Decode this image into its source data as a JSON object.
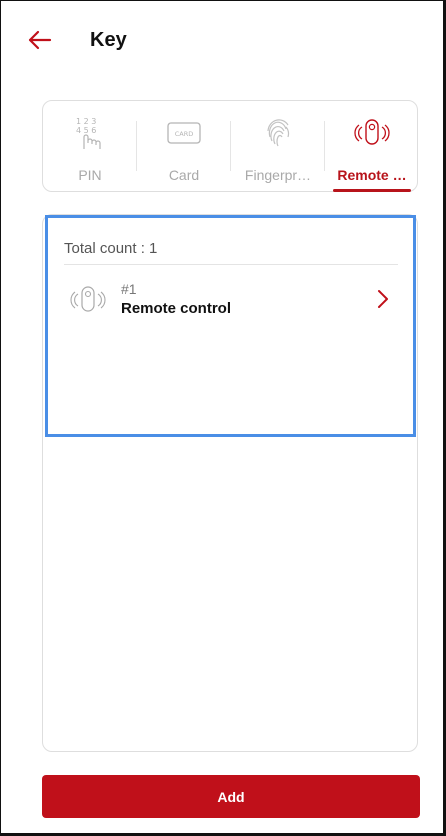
{
  "header": {
    "title": "Key",
    "back_icon": "arrow-left-icon"
  },
  "tabs": [
    {
      "label": "PIN",
      "icon": "pin-keypad-icon",
      "active": false
    },
    {
      "label": "Card",
      "icon": "card-icon",
      "card_text": "CARD",
      "active": false
    },
    {
      "label": "Fingerpr…",
      "icon": "fingerprint-icon",
      "active": false
    },
    {
      "label": "Remote …",
      "icon": "remote-control-icon",
      "active": true
    }
  ],
  "list": {
    "total_count_label": "Total count : 1",
    "items": [
      {
        "number": "#1",
        "name": "Remote control",
        "icon": "remote-control-icon"
      }
    ]
  },
  "footer": {
    "add_label": "Add"
  },
  "colors": {
    "accent": "#c0101a",
    "highlight": "#4a8ee6",
    "muted": "#a9a9a9"
  }
}
